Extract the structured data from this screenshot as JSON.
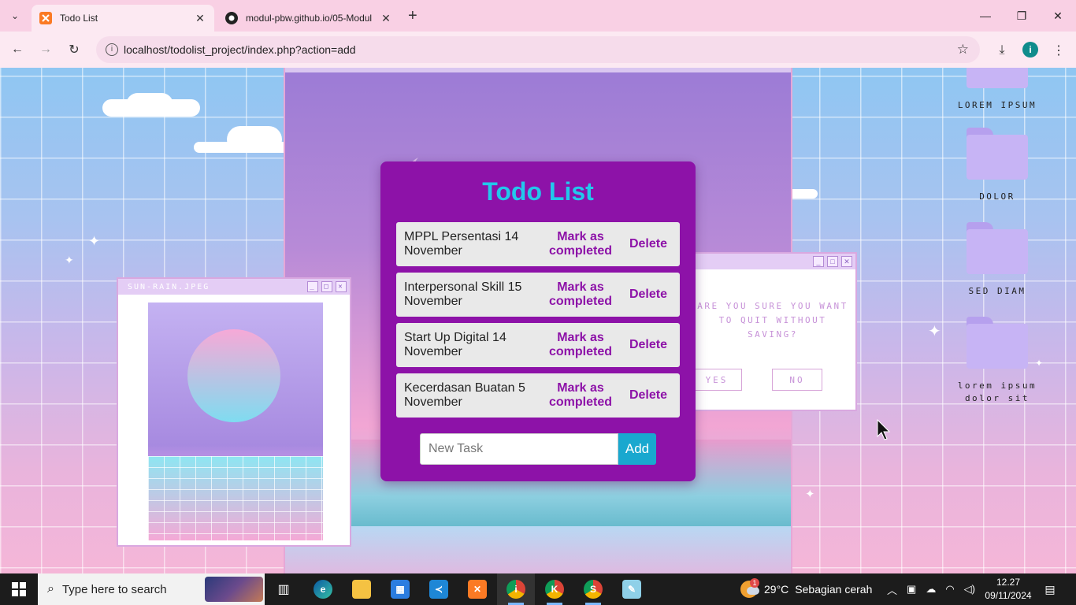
{
  "browser": {
    "tabs": [
      {
        "label": "Todo List",
        "active": true,
        "favicon": "xampp-icon"
      },
      {
        "label": "modul-pbw.github.io/05-Modul",
        "active": false,
        "favicon": "github-icon"
      }
    ],
    "url": "localhost/todolist_project/index.php?action=add",
    "profile_initial": "i"
  },
  "desktop": {
    "image_window_title": "SUN-RAIN.JPEG",
    "dialog": {
      "message": "ARE YOU SURE YOU WANT TO QUIT WITHOUT SAVING?",
      "yes": "YES",
      "no": "NO"
    },
    "folders": [
      {
        "label": "LOREM IPSUM"
      },
      {
        "label": "DOLOR"
      },
      {
        "label": "SED DIAM"
      },
      {
        "label": "lorem ipsum dolor sit"
      }
    ]
  },
  "todo": {
    "title": "Todo List",
    "tasks": [
      {
        "name": "MPPL Persentasi 14 November",
        "mark_label": "Mark as completed",
        "delete_label": "Delete"
      },
      {
        "name": "Interpersonal Skill 15 November",
        "mark_label": "Mark as completed",
        "delete_label": "Delete"
      },
      {
        "name": "Start Up Digital 14 November",
        "mark_label": "Mark as completed",
        "delete_label": "Delete"
      },
      {
        "name": "Kecerdasan Buatan 5 November",
        "mark_label": "Mark as completed",
        "delete_label": "Delete"
      }
    ],
    "new_task_placeholder": "New Task",
    "add_label": "Add"
  },
  "taskbar": {
    "search_placeholder": "Type here to search",
    "weather_badge": "1",
    "weather_temp": "29°C",
    "weather_desc": "Sebagian cerah",
    "time": "12.27",
    "date": "09/11/2024"
  }
}
